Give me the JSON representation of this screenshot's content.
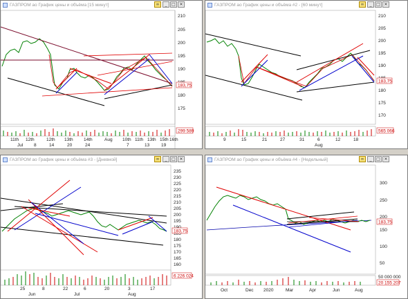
{
  "panes": [
    {
      "title": "ГАЗПРОМ ао График цены и объёма [15 минут]",
      "price_ticks": [
        "210",
        "205",
        "200",
        "195",
        "190",
        "185",
        "180",
        "175"
      ],
      "price_tag": "183,75",
      "volume_tag": "299 589",
      "date_row1": [
        "11th",
        "12th",
        "12th",
        "13th",
        "14th",
        "Aug",
        "10th",
        "11th",
        "13th",
        "15th",
        "16th"
      ],
      "date_row2": [
        "Jul",
        "8",
        "14",
        "20",
        "24",
        "",
        "7",
        "13",
        "19"
      ]
    },
    {
      "title": "ГАЗПРОМ ао График цены и объёма #2 - [60 минут]",
      "price_ticks": [
        "210",
        "205",
        "200",
        "195",
        "190",
        "185",
        "180",
        "175",
        "170"
      ],
      "price_tag": "183,75",
      "volume_tag": "565 066",
      "date_row1": [
        "9",
        "15",
        "21",
        "27",
        "31",
        "6",
        "12",
        "18"
      ],
      "date_row2": [
        "",
        "",
        "",
        "",
        "",
        "Aug",
        "",
        ""
      ]
    },
    {
      "title": "ГАЗПРОМ ао График цены и объёма #3 - [Дневной]",
      "price_ticks": [
        "235",
        "230",
        "225",
        "220",
        "215",
        "210",
        "205",
        "200",
        "195",
        "190",
        "185",
        "180",
        "175",
        "170",
        "165",
        "160"
      ],
      "price_tag": "183,75",
      "volume_tag": "6 226 024",
      "date_row1": [
        "25",
        "8",
        "22",
        "6",
        "20",
        "3",
        "17"
      ],
      "date_row2": [
        "Jun",
        "",
        "Jul",
        "",
        "",
        "Aug",
        ""
      ]
    },
    {
      "title": "ГАЗПРОМ ао График цены и объёма #4 - [Недельный]",
      "price_ticks": [
        "300",
        "250",
        "200",
        "150",
        "100",
        "50"
      ],
      "price_tag": "183,75",
      "volume_tag": "20 155 207",
      "volume_top": "50 000 000",
      "date_row1": [
        "Oct",
        "Dec",
        "2020",
        "Mar",
        "Apr",
        "Jun",
        "Aug"
      ]
    }
  ],
  "colors": {
    "up": "#008000",
    "down": "#cc0000",
    "trend_red": "#e00000",
    "trend_black": "#000000",
    "trend_blue": "#0000cc",
    "ma": "#7a0a2a",
    "bg": "#ffffff",
    "tag": "#cc0000"
  }
}
